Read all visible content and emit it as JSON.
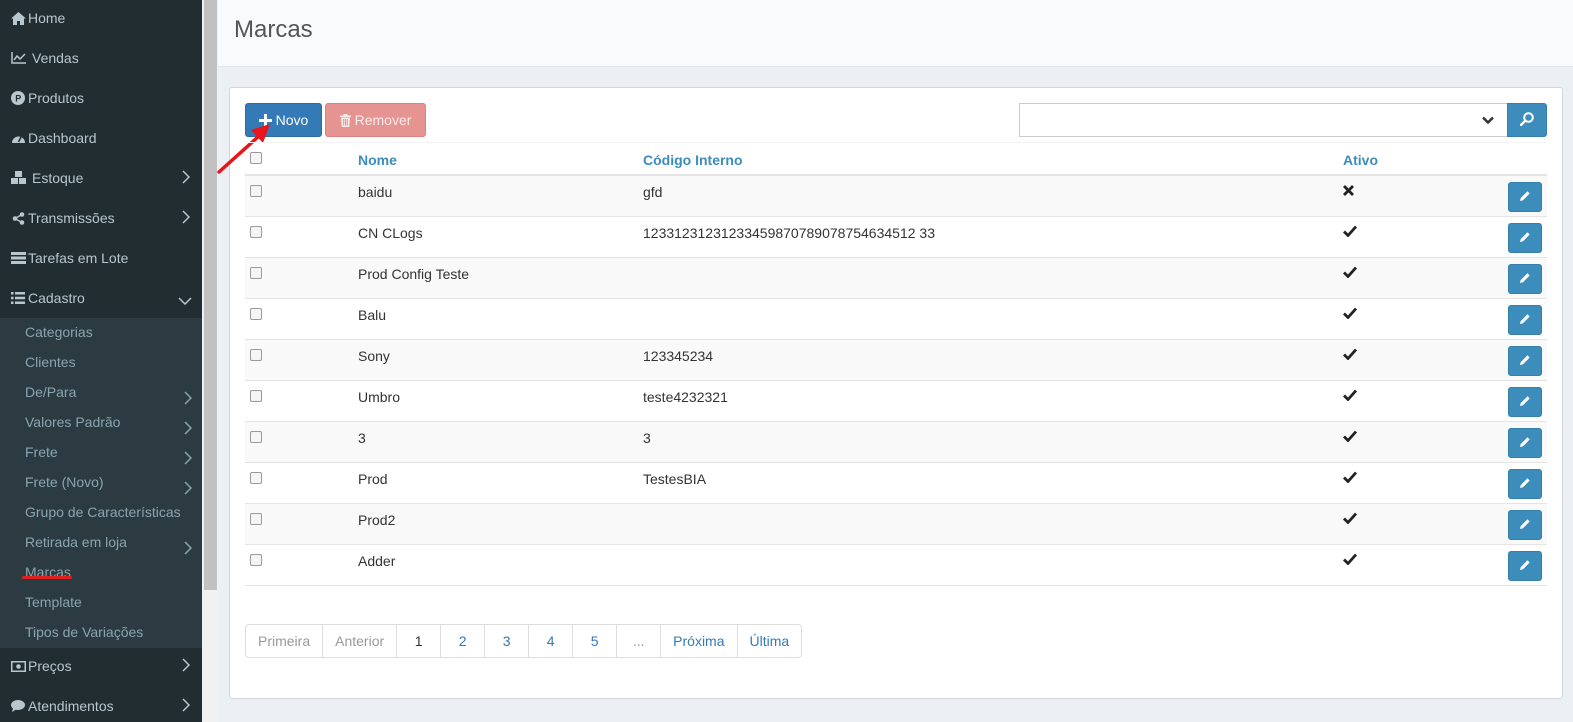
{
  "sidebar": {
    "items": [
      {
        "label": "Home",
        "icon": "home-icon"
      },
      {
        "label": "Vendas",
        "icon": "line-chart-icon"
      },
      {
        "label": "Produtos",
        "icon": "product-icon"
      },
      {
        "label": "Dashboard",
        "icon": "dashboard-icon"
      },
      {
        "label": "Estoque",
        "icon": "cubes-icon"
      },
      {
        "label": "Transmissões",
        "icon": "share-icon"
      },
      {
        "label": "Tarefas em Lote",
        "icon": "tasks-icon"
      },
      {
        "label": "Cadastro",
        "icon": "list-icon"
      }
    ],
    "submenu": [
      {
        "label": "Categorias"
      },
      {
        "label": "Clientes"
      },
      {
        "label": "De/Para"
      },
      {
        "label": "Valores Padrão"
      },
      {
        "label": "Frete"
      },
      {
        "label": "Frete (Novo)"
      },
      {
        "label": "Grupo de Características"
      },
      {
        "label": "Retirada em loja"
      },
      {
        "label": "Marcas"
      },
      {
        "label": "Template"
      },
      {
        "label": "Tipos de Variações"
      }
    ],
    "bottom_items": [
      {
        "label": "Preços",
        "icon": "money-icon"
      },
      {
        "label": "Atendimentos",
        "icon": "comment-icon"
      }
    ]
  },
  "header": {
    "title": "Marcas"
  },
  "toolbar": {
    "new_label": "Novo",
    "remove_label": "Remover",
    "search_value": ""
  },
  "table": {
    "columns": {
      "name": "Nome",
      "code": "Código Interno",
      "active": "Ativo"
    },
    "rows": [
      {
        "name": "baidu",
        "code": "gfd",
        "active": false
      },
      {
        "name": "CN CLogs",
        "code": "12331231231233459870789078754634512 33",
        "active": true
      },
      {
        "name": "Prod Config Teste",
        "code": "",
        "active": true
      },
      {
        "name": "Balu",
        "code": "",
        "active": true
      },
      {
        "name": "Sony",
        "code": "123345234",
        "active": true
      },
      {
        "name": "Umbro",
        "code": "teste4232321",
        "active": true
      },
      {
        "name": "3",
        "code": "3",
        "active": true
      },
      {
        "name": "Prod",
        "code": "TestesBIA",
        "active": true
      },
      {
        "name": "Prod2",
        "code": "",
        "active": true
      },
      {
        "name": "Adder",
        "code": "",
        "active": true
      }
    ]
  },
  "pagination": {
    "first": "Primeira",
    "prev": "Anterior",
    "pages": [
      "1",
      "2",
      "3",
      "4",
      "5",
      "..."
    ],
    "next": "Próxima",
    "last": "Última"
  },
  "colors": {
    "sidebar_bg": "#222d32",
    "primary": "#337ab7",
    "danger_light": "#e59491"
  }
}
